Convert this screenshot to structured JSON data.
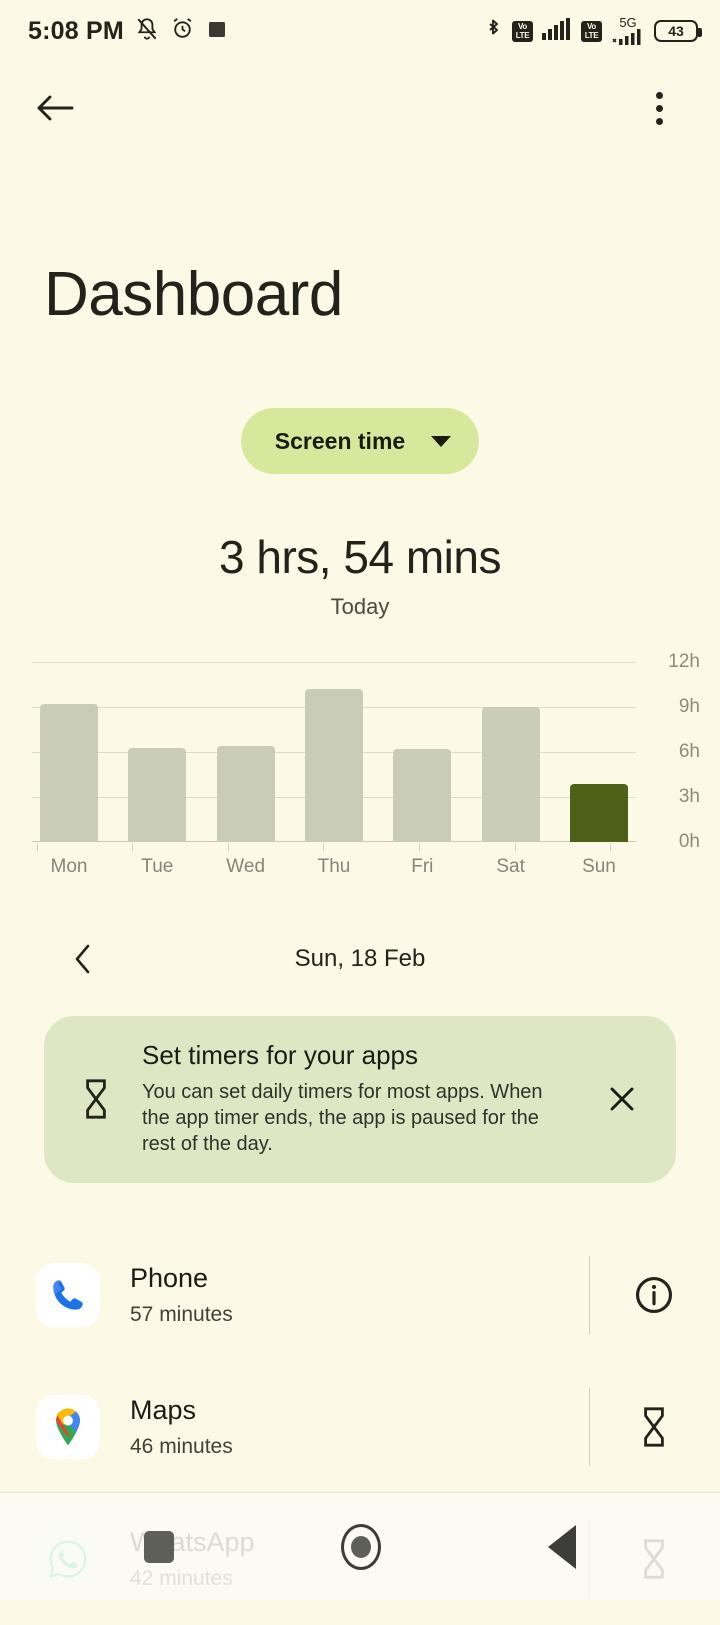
{
  "status_bar": {
    "time": "5:08 PM",
    "battery_percent": "43",
    "network_label": "5G",
    "volte_top": "Vo",
    "volte_bottom": "LTE",
    "icons": [
      "silent-bell-icon",
      "alarm-icon",
      "screen-record-icon",
      "bluetooth-icon",
      "volte-icon",
      "signal-icon",
      "volte-icon-2",
      "5g-signal-icon",
      "battery-icon"
    ]
  },
  "app_bar": {
    "back_icon": "back-arrow-icon",
    "overflow_icon": "more-options-icon"
  },
  "header": {
    "title": "Dashboard"
  },
  "filter_chip": {
    "label": "Screen time",
    "caret_icon": "chevron-down-icon"
  },
  "summary": {
    "total": "3 hrs, 54 mins",
    "period": "Today"
  },
  "chart_data": {
    "type": "bar",
    "title": "Screen time",
    "categories": [
      "Mon",
      "Tue",
      "Wed",
      "Thu",
      "Fri",
      "Sat",
      "Sun"
    ],
    "values": [
      9.2,
      6.3,
      6.4,
      10.2,
      6.2,
      9.0,
      3.9
    ],
    "value_unit": "hours",
    "xlabel": "",
    "ylabel": "",
    "ylim": [
      0,
      12
    ],
    "yticks": [
      0,
      3,
      6,
      9,
      12
    ],
    "ytick_labels": [
      "0h",
      "3h",
      "6h",
      "9h",
      "12h"
    ],
    "grid": true,
    "legend": "none",
    "highlight_index": 6,
    "bar_color": "#C9CDB7",
    "highlight_color": "#4D6119"
  },
  "date_nav": {
    "prev_icon": "chevron-left-icon",
    "date": "Sun, 18 Feb"
  },
  "promo_card": {
    "icon": "hourglass-icon",
    "title": "Set timers for your apps",
    "body": "You can set daily timers for most apps. When the app timer ends, the app is paused for the rest of the day.",
    "close_icon": "close-icon"
  },
  "app_list": [
    {
      "name": "Phone",
      "usage": "57 minutes",
      "icon": "phone-app-icon",
      "trailing_icon": "info-icon"
    },
    {
      "name": "Maps",
      "usage": "46 minutes",
      "icon": "maps-app-icon",
      "trailing_icon": "hourglass-icon"
    },
    {
      "name": "WhatsApp",
      "usage": "42 minutes",
      "icon": "whatsapp-app-icon",
      "trailing_icon": "hourglass-icon"
    }
  ],
  "nav_bar": {
    "recents_label": "recents-button",
    "home_label": "home-button",
    "back_label": "back-button"
  },
  "colors": {
    "background": "#FCFAE6",
    "chip": "#D6E89B",
    "card": "#DFE6C4",
    "accent": "#4D6119",
    "bar": "#C9CDB7"
  }
}
